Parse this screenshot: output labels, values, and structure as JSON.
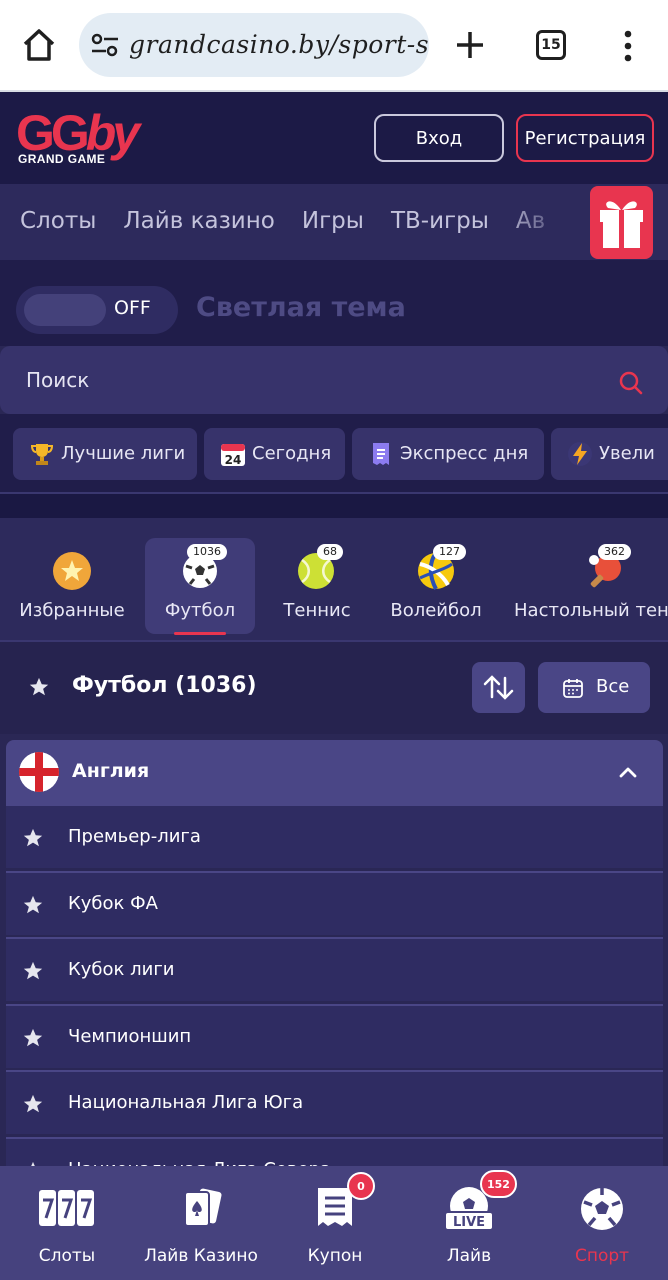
{
  "browser": {
    "url": "grandcasino.by/sport-st",
    "tab_count": "15"
  },
  "header": {
    "logo_main": "GG",
    "logo_by": "by",
    "logo_sub": "GRAND GAME",
    "login_label": "Вход",
    "register_label": "Регистрация"
  },
  "nav": {
    "items": [
      "Слоты",
      "Лайв казино",
      "Игры",
      "ТВ-игры",
      "Ав"
    ]
  },
  "theme": {
    "toggle_state": "OFF",
    "label": "Светлая тема"
  },
  "search": {
    "placeholder": "Поиск"
  },
  "chips": [
    {
      "label": "Лучшие лиги",
      "icon": "trophy-icon"
    },
    {
      "label": "Сегодня",
      "icon": "calendar-icon",
      "date": "24"
    },
    {
      "label": "Экспресс дня",
      "icon": "receipt-icon"
    },
    {
      "label": "Увели",
      "icon": "lightning-icon"
    }
  ],
  "sports": [
    {
      "label": "Избранные",
      "count": null
    },
    {
      "label": "Футбол",
      "count": "1036"
    },
    {
      "label": "Теннис",
      "count": "68"
    },
    {
      "label": "Волейбол",
      "count": "127"
    },
    {
      "label": "Настольный тен",
      "count": "362"
    }
  ],
  "section": {
    "title": "Футбол (1036)",
    "date_filter": "Все"
  },
  "country": {
    "name": "Англия"
  },
  "leagues": [
    "Премьер-лига",
    "Кубок ФА",
    "Кубок лиги",
    "Чемпионшип",
    "Национальная Лига Юга",
    "Национальная Лига Севера"
  ],
  "bottom_nav": [
    {
      "label": "Слоты",
      "badge": null
    },
    {
      "label": "Лайв Казино",
      "badge": null
    },
    {
      "label": "Купон",
      "badge": "0"
    },
    {
      "label": "Лайв",
      "badge": "152",
      "icon_text": "LIVE"
    },
    {
      "label": "Спорт",
      "badge": null
    }
  ],
  "colors": {
    "accent": "#e8354f",
    "header_bg": "#1c1a46",
    "panel": "#2d2a5c",
    "card": "#4a4686"
  }
}
